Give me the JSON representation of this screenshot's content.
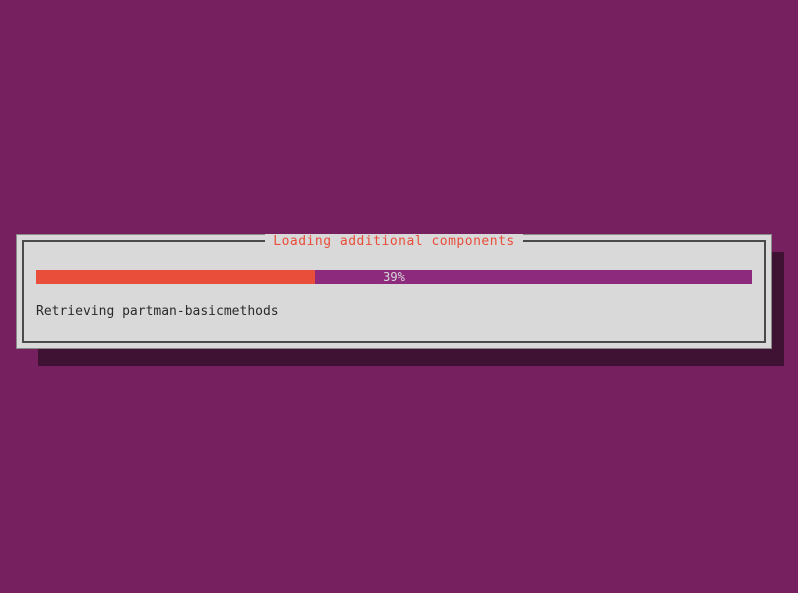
{
  "dialog": {
    "title": "Loading additional components",
    "progress_percent": 39,
    "progress_label": "39%",
    "status_text": "Retrieving partman-basicmethods"
  },
  "colors": {
    "background": "#772060",
    "dialog_bg": "#d9d9d9",
    "title_color": "#e94e3a",
    "progress_fill": "#e94e3a",
    "progress_bg": "#8e2a7e"
  }
}
